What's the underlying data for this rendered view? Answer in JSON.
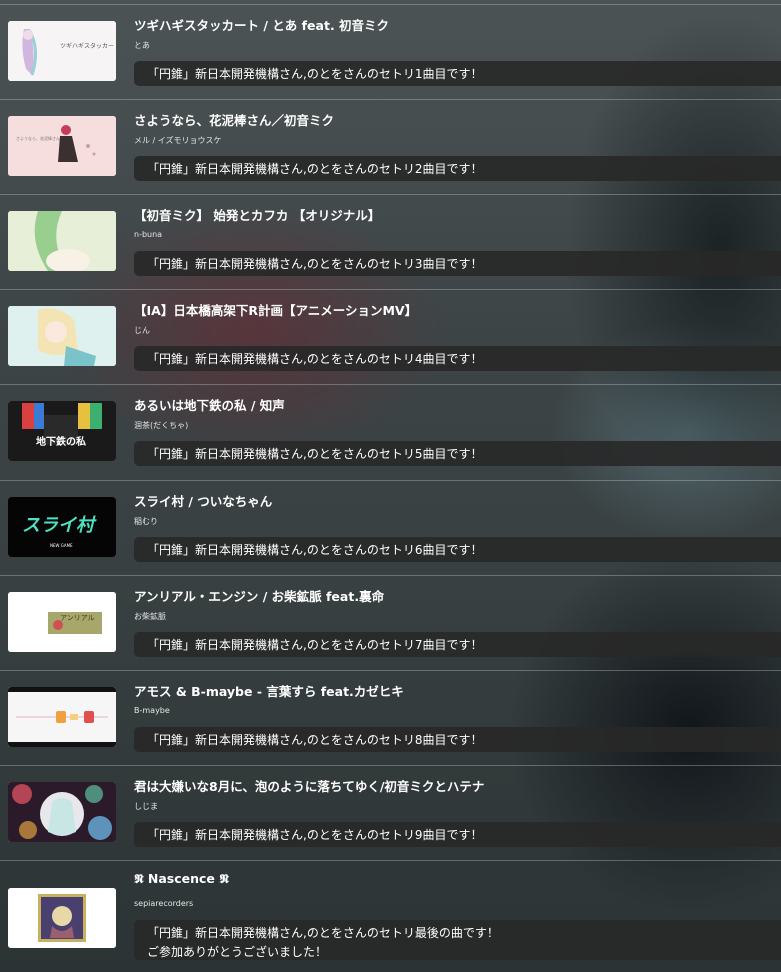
{
  "playlist": [
    {
      "title": "ツギハギスタッカート / とあ feat. 初音ミク",
      "artist": "とあ",
      "comment": "「円錐」新日本開発機構さん,のとをさんのセトリ1曲目です！",
      "thumbnail": {
        "caption": "ツギハギスタッカート",
        "palette": [
          "#f7f4f6",
          "#c7a8d8",
          "#9ad0d6"
        ]
      }
    },
    {
      "title": "さようなら、花泥棒さん／初音ミク",
      "artist": "メル / イズモリョウスケ",
      "comment": "「円錐」新日本開発機構さん,のとをさんのセトリ2曲目です！",
      "thumbnail": {
        "caption": "さようなら、花泥棒さん",
        "palette": [
          "#f6dede",
          "#c83c5a",
          "#3a3030"
        ]
      }
    },
    {
      "title": "【初音ミク】 始発とカフカ 【オリジナル】",
      "artist": "n-buna",
      "comment": "「円錐」新日本開発機構さん,のとをさんのセトリ3曲目です！",
      "thumbnail": {
        "caption": "",
        "palette": [
          "#e7efd9",
          "#98cf8e",
          "#f7f1e6"
        ]
      }
    },
    {
      "title": "【IA】日本橋高架下R計画【アニメーションMV】",
      "artist": "じん",
      "comment": "「円錐」新日本開発機構さん,のとをさんのセトリ4曲目です！",
      "thumbnail": {
        "caption": "",
        "palette": [
          "#dff1ee",
          "#f4e3b3",
          "#7ac3c8"
        ]
      }
    },
    {
      "title": "あるいは地下鉄の私 / 知声",
      "artist": "涸茶(だくちゃ)",
      "comment": "「円錐」新日本開発機構さん,のとをさんのセトリ5曲目です！",
      "thumbnail": {
        "caption": "地下鉄の私",
        "palette": [
          "#1a1a1a",
          "#d94040",
          "#3b7bd6"
        ]
      }
    },
    {
      "title": "スライ村 / ついなちゃん",
      "artist": "稲むり",
      "comment": "「円錐」新日本開発機構さん,のとをさんのセトリ6曲目です！",
      "thumbnail": {
        "caption": "スライ村",
        "sub_caption": "NEW GAME",
        "palette": [
          "#050505",
          "#4de1c1",
          "#ffffff"
        ]
      }
    },
    {
      "title": "アンリアル・エンジン / お柴鉱脈 feat.裏命",
      "artist": "お柴鉱脈",
      "comment": "「円錐」新日本開発機構さん,のとをさんのセトリ7曲目です！",
      "thumbnail": {
        "caption": "アンリアル",
        "palette": [
          "#ffffff",
          "#8a8a3a",
          "#d05050"
        ]
      }
    },
    {
      "title": "アモス & B-maybe - 言葉すら feat.カゼヒキ",
      "artist": "B-maybe",
      "comment": "「円錐」新日本開発機構さん,のとをさんのセトリ8曲目です！",
      "thumbnail": {
        "caption": "",
        "palette": [
          "#f6f6f6",
          "#f0a040",
          "#e05050"
        ]
      }
    },
    {
      "title": "君は大嫌いな8月に、泡のように落ちてゆく/初音ミクとハテナ",
      "artist": "しじま",
      "comment": "「円錐」新日本開発機構さん,のとをさんのセトリ9曲目です！",
      "thumbnail": {
        "caption": "",
        "palette": [
          "#2a1a2a",
          "#d85060",
          "#6ab0e0"
        ]
      }
    },
    {
      "title": "𝕹 Nascence 𝕹",
      "artist": "sepiarecorders",
      "comment": "「円錐」新日本開発機構さん,のとをさんのセトリ最後の曲です！",
      "comment_line2": "ご参加ありがとうございました！",
      "thumbnail": {
        "caption": "",
        "palette": [
          "#ffffff",
          "#c8b060",
          "#4a4070"
        ]
      }
    }
  ]
}
